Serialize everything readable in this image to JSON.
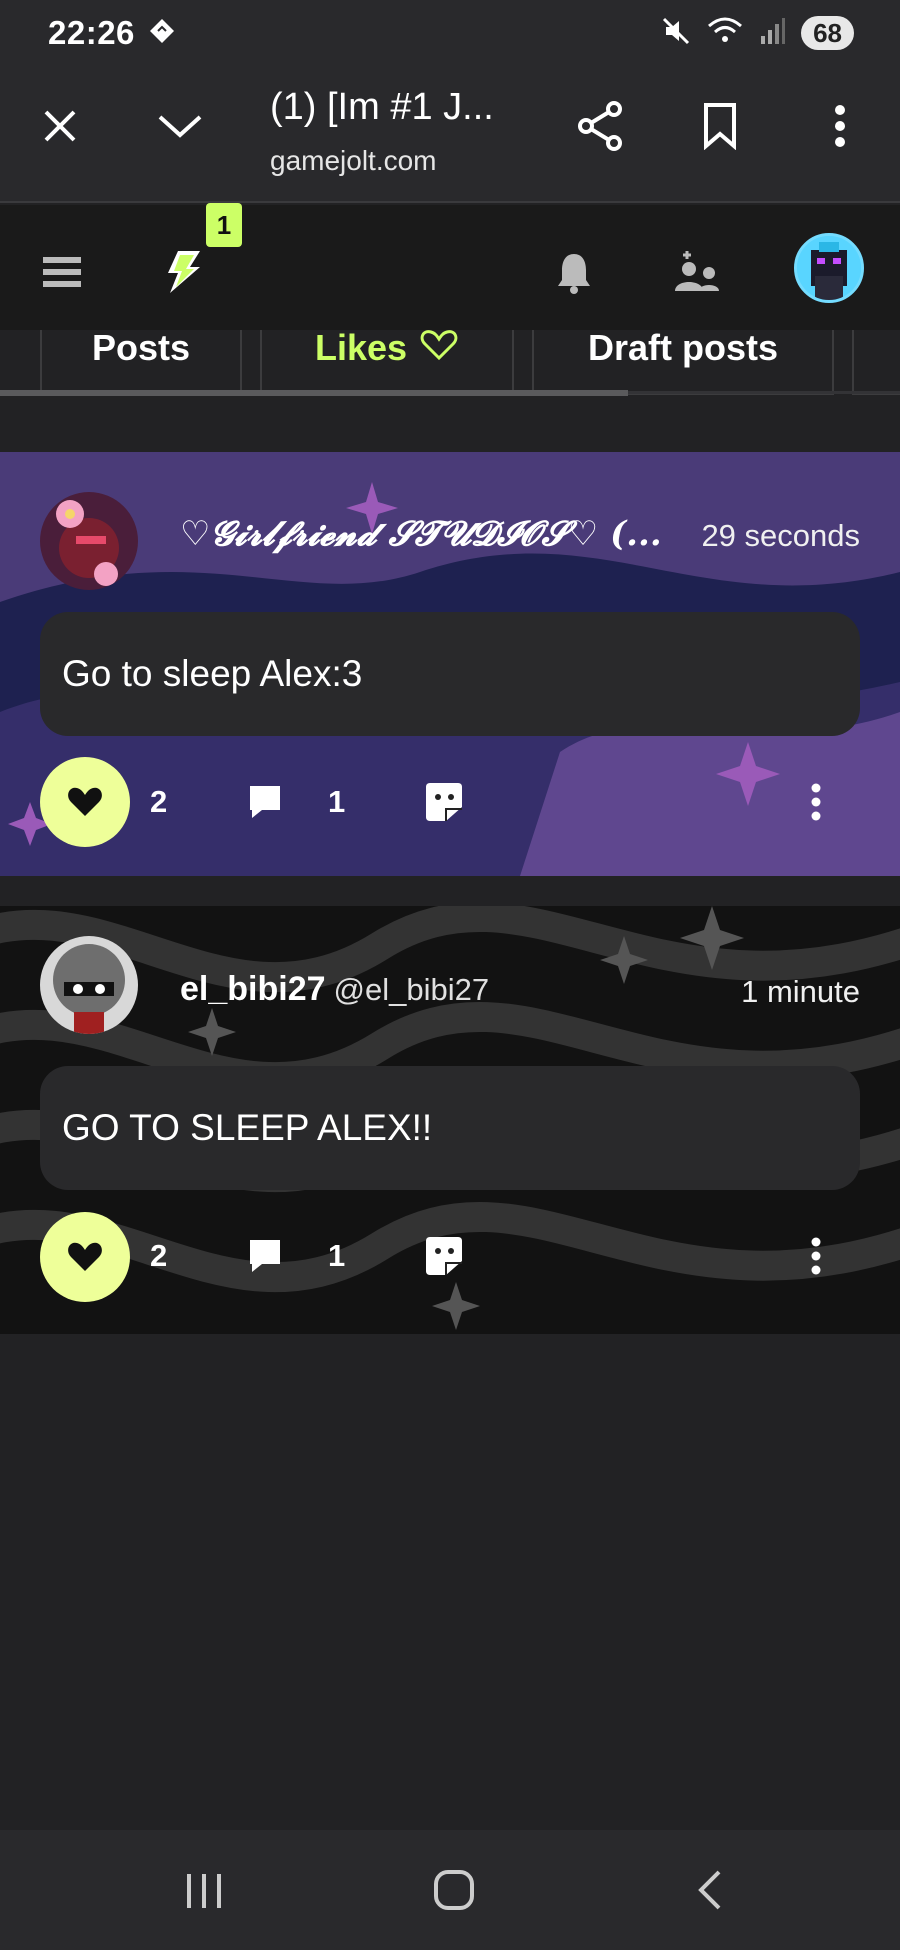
{
  "status_bar": {
    "time": "22:26",
    "battery": "68",
    "icons": [
      "tiktok-diamond-icon",
      "mute-icon",
      "wifi-icon",
      "signal-icon"
    ]
  },
  "browser": {
    "tab_title": "(1) [Im #1 J...",
    "url": "gamejolt.com",
    "buttons": [
      "close-icon",
      "chevron-down-icon",
      "share-icon",
      "bookmark-icon",
      "more-vert-icon"
    ]
  },
  "gj_nav": {
    "notification_badge": "1",
    "icons": [
      "menu-icon",
      "gamejolt-bolt-icon",
      "bell-icon",
      "friend-requests-icon",
      "user-avatar"
    ]
  },
  "profile_tabs": [
    {
      "label": "Posts",
      "active": false
    },
    {
      "label": "Likes",
      "active": true
    },
    {
      "label": "Draft posts",
      "active": false
    }
  ],
  "posts": [
    {
      "author": "♡𝓖𝓲𝓻𝓵𝓯𝓻𝓲𝓮𝓷𝓭 𝓢𝓣𝓤𝓓𝓘𝓞𝓢♡ (...",
      "handle": "",
      "time": "29 seconds",
      "body": "Go to sleep Alex:3",
      "likes": "2",
      "comments": "1",
      "background": "#2a2650"
    },
    {
      "author": "el_bibi27",
      "handle": "@el_bibi27",
      "time": "1 minute",
      "body": "GO TO SLEEP ALEX!!",
      "likes": "2",
      "comments": "1",
      "background": "#111111"
    }
  ],
  "colors": {
    "accent": "#ccff66",
    "like_bg": "#eeff99",
    "surface": "#29292c",
    "page": "#222224"
  }
}
